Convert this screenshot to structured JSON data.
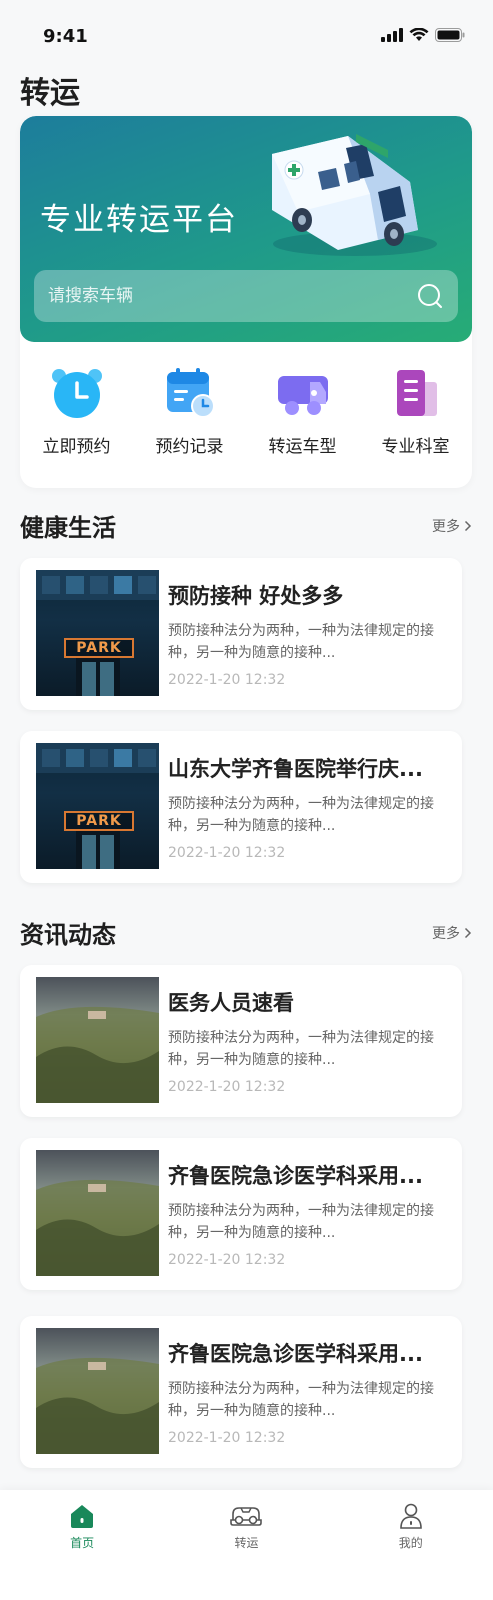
{
  "status_bar": {
    "time": "9:41"
  },
  "page": {
    "title": "转运"
  },
  "banner": {
    "title": "专业转运平台",
    "search_placeholder": "请搜索车辆"
  },
  "quick_actions": [
    {
      "label": "立即预约",
      "icon": "alarm-clock-icon"
    },
    {
      "label": "预约记录",
      "icon": "calendar-icon"
    },
    {
      "label": "转运车型",
      "icon": "truck-icon"
    },
    {
      "label": "专业科室",
      "icon": "building-icon"
    }
  ],
  "health_section": {
    "title": "健康生活",
    "more": "更多",
    "items": [
      {
        "title": "预防接种 好处多多",
        "desc": "预防接种法分为两种，一种为法律规定的接种，另一种为随意的接种...",
        "time": "2022-1-20 12:32",
        "thumb_text": "PARK"
      },
      {
        "title": "山东大学齐鲁医院举行庆...",
        "desc": "预防接种法分为两种，一种为法律规定的接种，另一种为随意的接种...",
        "time": "2022-1-20 12:32",
        "thumb_text": "PARK"
      }
    ]
  },
  "news_section": {
    "title": "资讯动态",
    "more": "更多",
    "items": [
      {
        "title": "医务人员速看",
        "desc": "预防接种法分为两种，一种为法律规定的接种，另一种为随意的接种...",
        "time": "2022-1-20 12:32"
      },
      {
        "title": "齐鲁医院急诊医学科采用...",
        "desc": "预防接种法分为两种，一种为法律规定的接种，另一种为随意的接种...",
        "time": "2022-1-20 12:32"
      },
      {
        "title": "齐鲁医院急诊医学科采用...",
        "desc": "预防接种法分为两种，一种为法律规定的接种，另一种为随意的接种...",
        "time": "2022-1-20 12:32"
      }
    ]
  },
  "tab_bar": {
    "items": [
      {
        "label": "首页",
        "icon": "home-icon",
        "active": true
      },
      {
        "label": "转运",
        "icon": "car-icon",
        "active": false
      },
      {
        "label": "我的",
        "icon": "user-icon",
        "active": false
      }
    ]
  },
  "colors": {
    "primary": "#19885a",
    "banner_start": "#1d7d9c",
    "banner_end": "#27ac76"
  }
}
